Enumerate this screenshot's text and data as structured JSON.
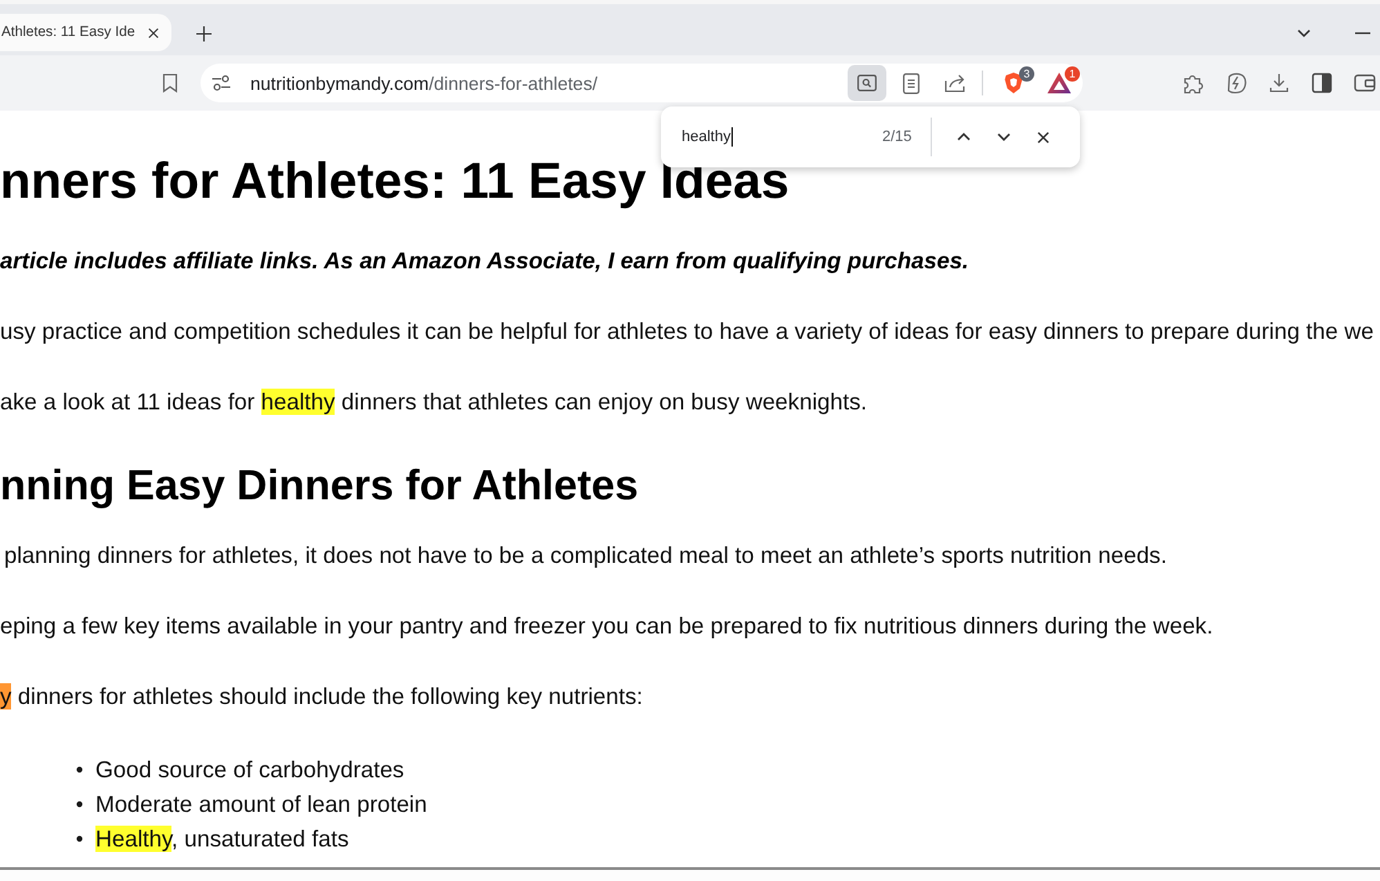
{
  "tabs": [
    {
      "title": "Athletes: 11 Easy Ide",
      "selected": true
    }
  ],
  "address_bar": {
    "domain": "nutritionbymandy.com",
    "path": "/dinners-for-athletes/",
    "page_actions": [
      {
        "kind": "find",
        "active": true
      },
      {
        "kind": "reader",
        "active": false
      },
      {
        "kind": "share",
        "active": false
      }
    ],
    "extensions": [
      {
        "kind": "shields",
        "badge": "3"
      },
      {
        "kind": "rewards",
        "badge": "1"
      }
    ]
  },
  "find_bar": {
    "query": "healthy",
    "count": "2/15"
  },
  "article": [
    {
      "kind": "h1",
      "text": "nners for Athletes: 11 Easy Ideas"
    },
    {
      "kind": "note",
      "text": "article includes affiliate links. As an Amazon Associate, I earn from qualifying purchases."
    },
    {
      "kind": "p",
      "segments": [
        {
          "text": "usy practice and competition schedules it can be helpful for athletes to have a variety of ideas for easy dinners to prepare during the we",
          "highlighted": false,
          "current": false
        }
      ]
    },
    {
      "kind": "p",
      "segments": [
        {
          "text": "ake a look at 11 ideas for ",
          "highlighted": false,
          "current": false
        },
        {
          "text": "healthy",
          "highlighted": true,
          "current": false
        },
        {
          "text": " dinners that athletes can enjoy on busy weeknights.",
          "highlighted": false,
          "current": false
        }
      ]
    },
    {
      "kind": "h2",
      "text": "nning Easy Dinners for Athletes"
    },
    {
      "kind": "p",
      "segments": [
        {
          "text": "planning dinners for athletes, it does not have to be a complicated meal to meet an athlete’s sports nutrition needs.",
          "highlighted": false,
          "current": false
        }
      ]
    },
    {
      "kind": "p",
      "segments": [
        {
          "text": "eping a few key items available in your pantry and freezer you can be prepared to fix nutritious dinners during the week.",
          "highlighted": false,
          "current": false
        }
      ]
    },
    {
      "kind": "p",
      "segments": [
        {
          "text": "y",
          "highlighted": true,
          "current": true
        },
        {
          "text": " dinners for athletes should include the following key nutrients:",
          "highlighted": false,
          "current": false
        }
      ]
    },
    {
      "kind": "list",
      "items": [
        {
          "segments": [
            {
              "text": "Good source of carbohydrates",
              "highlighted": false,
              "current": false
            }
          ]
        },
        {
          "segments": [
            {
              "text": "Moderate amount of lean protein",
              "highlighted": false,
              "current": false
            }
          ]
        },
        {
          "segments": [
            {
              "text": "Healthy",
              "highlighted": true,
              "current": false
            },
            {
              "text": ", unsaturated fats",
              "highlighted": false,
              "current": false
            }
          ]
        }
      ]
    }
  ]
}
